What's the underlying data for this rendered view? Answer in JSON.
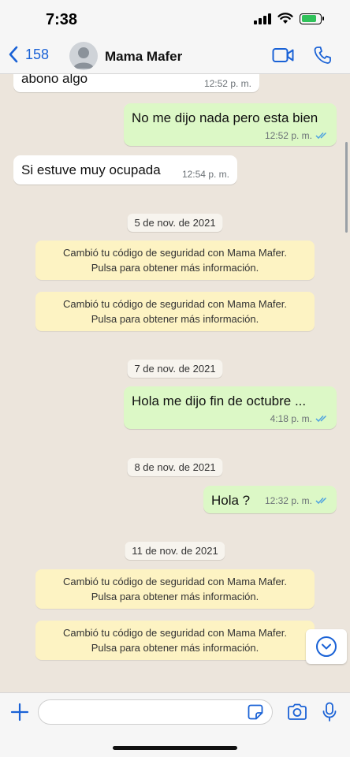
{
  "status_bar": {
    "time": "7:38",
    "battery_level": 0.8
  },
  "header": {
    "back_count": "158",
    "contact_name": "Mama Mafer",
    "accent": "#1a62d6"
  },
  "messages": [
    {
      "type": "in",
      "text": "abono algo",
      "time": "12:52 p. m."
    },
    {
      "type": "out",
      "text": "No me dijo nada pero esta bien",
      "time": "12:52 p. m.",
      "read": true
    },
    {
      "type": "in",
      "text": "Si estuve muy ocupada",
      "time": "12:54 p. m."
    },
    {
      "type": "date",
      "text": "5 de nov. de 2021"
    },
    {
      "type": "system",
      "line1": "Cambió tu código de seguridad con Mama Mafer.",
      "line2": "Pulsa para obtener más información."
    },
    {
      "type": "system",
      "line1": "Cambió tu código de seguridad con Mama Mafer.",
      "line2": "Pulsa para obtener más información."
    },
    {
      "type": "date",
      "text": "7 de nov. de 2021"
    },
    {
      "type": "out",
      "text": "Hola me dijo fin de octubre ...",
      "time": "4:18 p. m.",
      "read": true
    },
    {
      "type": "date",
      "text": "8 de nov. de 2021"
    },
    {
      "type": "out",
      "text": "Hola ?",
      "time": "12:32 p. m.",
      "read": true
    },
    {
      "type": "date",
      "text": "11 de nov. de 2021"
    },
    {
      "type": "system",
      "line1": "Cambió tu código de seguridad con Mama Mafer.",
      "line2": "Pulsa para obtener más información."
    },
    {
      "type": "system",
      "line1": "Cambió tu código de seguridad con Mama Mafer.",
      "line2": "Pulsa para obtener más información."
    }
  ],
  "composer": {
    "value": "",
    "placeholder": ""
  },
  "icons": {
    "back": "chevron-left-icon",
    "video": "video-camera-icon",
    "call": "phone-icon",
    "add": "plus-icon",
    "sticker": "sticker-icon",
    "camera": "camera-icon",
    "mic": "microphone-icon",
    "scroll_down": "chevron-down-icon"
  }
}
